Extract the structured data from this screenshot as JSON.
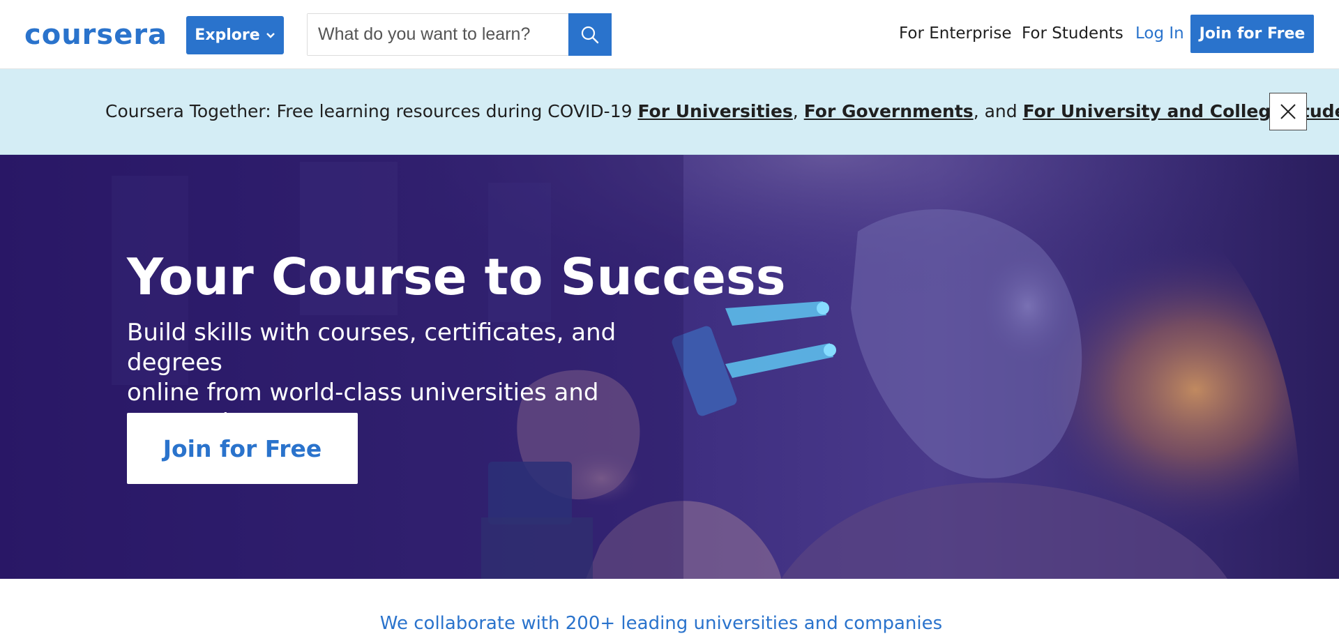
{
  "header": {
    "logo_text": "coursera",
    "explore_label": "Explore",
    "search": {
      "placeholder": "What do you want to learn?"
    },
    "nav": {
      "enterprise": "For Enterprise",
      "students": "For Students",
      "login": "Log In",
      "join": "Join for Free"
    }
  },
  "banner": {
    "prefix": "Coursera Together: Free learning resources during COVID-19 ",
    "link_universities": "For Universities",
    "sep1": ", ",
    "link_governments": "For Governments",
    "sep2": ", and ",
    "link_students": "For University and College Students"
  },
  "hero": {
    "title": "Your Course to Success",
    "subtitle_line1": "Build skills with courses, certificates, and degrees",
    "subtitle_line2": "online from world-class universities and companies",
    "join_label": "Join for Free"
  },
  "collab": {
    "text": "We collaborate with 200+ leading universities and companies"
  },
  "colors": {
    "brand_blue": "#2a73cc",
    "banner_bg": "#d4edf5",
    "hero_bg": "#2b1a66"
  },
  "icons": {
    "search": "search-icon",
    "explore_chevron": "chevron-down-icon",
    "close": "close-icon"
  }
}
